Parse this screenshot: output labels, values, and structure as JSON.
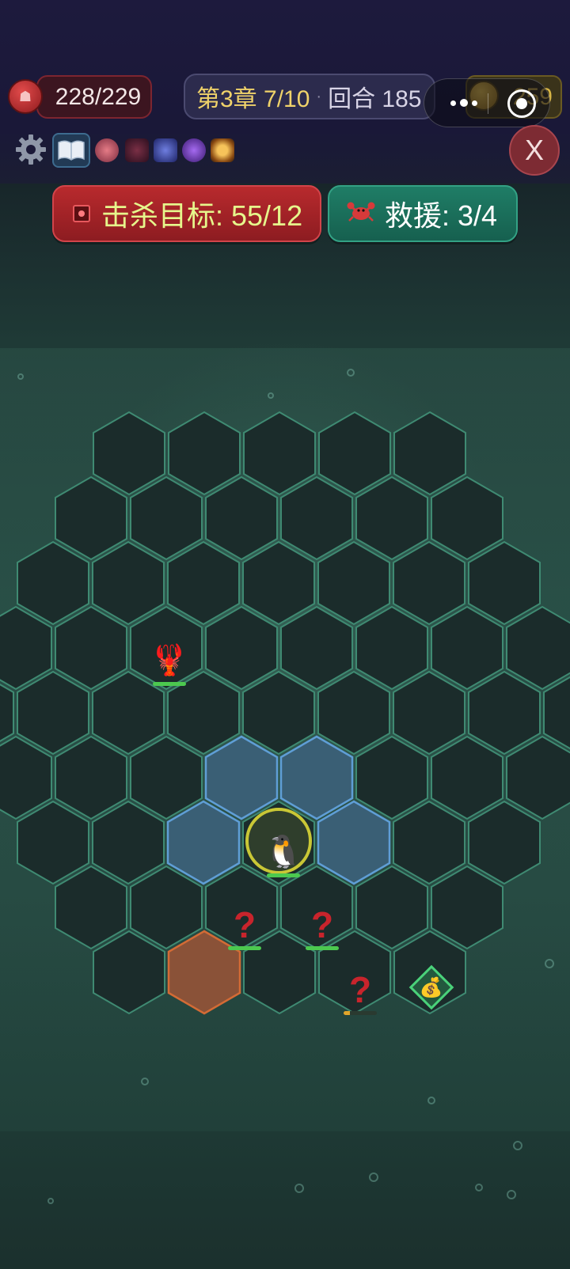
{
  "hud": {
    "hp": "228/229",
    "chapter": "第3章 7/10",
    "separator": "·",
    "turn": "回合 185",
    "coins": "259",
    "close_label": "X"
  },
  "objectives": {
    "kill": "击杀目标: 55/12",
    "rescue": "救援: 3/4"
  },
  "status_icons": [
    "gear-icon",
    "book-icon",
    "claw-buff-icon",
    "dark-buff-icon",
    "storm-buff-icon",
    "vortex-buff-icon",
    "sun-buff-icon"
  ],
  "colors": {
    "hex_default": "#1b2c2b",
    "hex_stroke": "#3f8a72",
    "hex_move": "#3a5f75",
    "hex_move_stroke": "#5f9ed6",
    "hex_danger": "#8a5238",
    "hex_danger_stroke": "#d36b35",
    "selection_ring": "#c9c736"
  },
  "units": {
    "enemy_lobster": {
      "glyph": "🦞",
      "hp": 1.0
    },
    "player_penguin": {
      "glyph": "🐧",
      "hp": 1.0
    },
    "unknown_1": {
      "glyph": "?",
      "hp": 1.0
    },
    "unknown_2": {
      "glyph": "?",
      "hp": 1.0
    },
    "unknown_3": {
      "glyph": "?",
      "hp": 0.2
    },
    "treasure": {
      "glyph": "💰"
    }
  }
}
